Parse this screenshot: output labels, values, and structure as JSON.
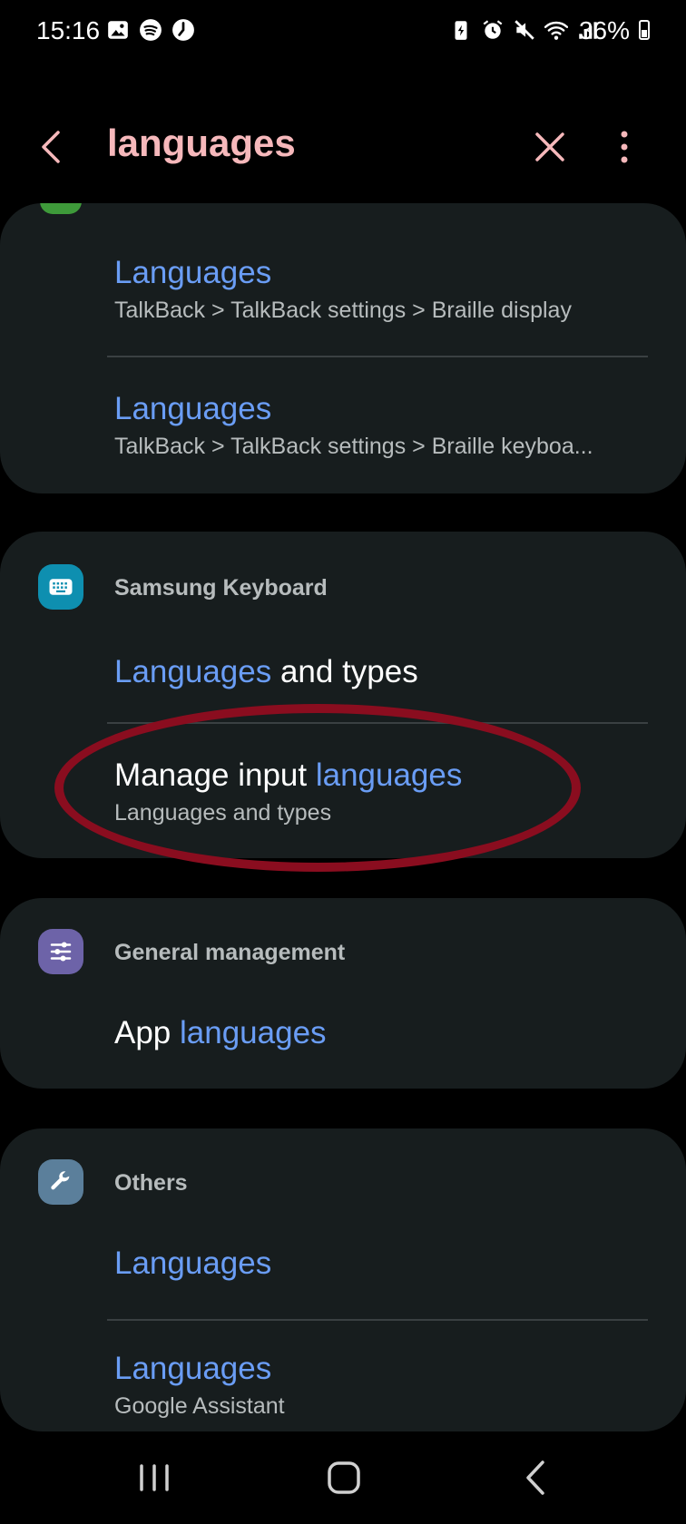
{
  "status_bar": {
    "time": "15:16",
    "battery_percent": "36%"
  },
  "header": {
    "search_query": "languages"
  },
  "groups": [
    {
      "items": [
        {
          "title_highlight": "Languages",
          "subtitle": "TalkBack > TalkBack settings > Braille display"
        },
        {
          "title_highlight": "Languages",
          "subtitle": "TalkBack > TalkBack settings > Braille keyboa..."
        }
      ]
    },
    {
      "app_name": "Samsung Keyboard",
      "app_icon": "keyboard-icon",
      "items": [
        {
          "title_highlight": "Languages",
          "title_after": " and types"
        },
        {
          "title_before": "Manage input ",
          "title_highlight": "languages",
          "subtitle": "Languages and types"
        }
      ]
    },
    {
      "app_name": "General management",
      "app_icon": "sliders-icon",
      "items": [
        {
          "title_before": "App ",
          "title_highlight": "languages"
        }
      ]
    },
    {
      "app_name": "Others",
      "app_icon": "wrench-icon",
      "items": [
        {
          "title_highlight": "Languages"
        },
        {
          "title_highlight": "Languages",
          "subtitle": "Google Assistant"
        }
      ]
    }
  ],
  "colors": {
    "background": "#000000",
    "card": "#171d1e",
    "highlight": "#6a9df5",
    "search_text": "#f6b8bb",
    "annotation": "#8a0d1f",
    "keyboard_icon_bg": "#0e8fb0",
    "general_icon_bg": "#6d63a8",
    "others_icon_bg": "#5b7f9b"
  }
}
